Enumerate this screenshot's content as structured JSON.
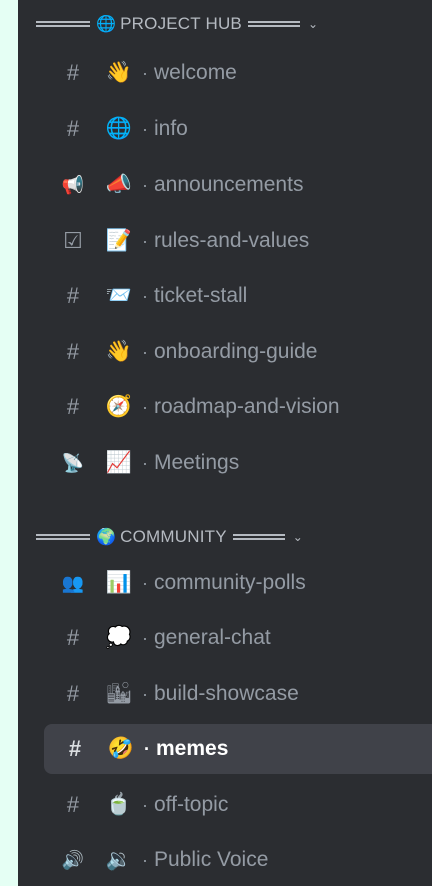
{
  "categories": [
    {
      "label": "PROJECT HUB",
      "emoji": "🌐"
    },
    {
      "label": "COMMUNITY",
      "emoji": "🌍"
    }
  ],
  "channels": [
    {
      "icon": "#",
      "emoji": "👋",
      "name": "welcome"
    },
    {
      "icon": "#",
      "emoji": "🌐",
      "name": "info"
    },
    {
      "icon": "📢",
      "emoji": "📣",
      "name": "announcements"
    },
    {
      "icon": "☑",
      "emoji": "📝",
      "name": "rules-and-values"
    },
    {
      "icon": "#",
      "emoji": "📨",
      "name": "ticket-stall"
    },
    {
      "icon": "#",
      "emoji": "👋",
      "name": "onboarding-guide"
    },
    {
      "icon": "#",
      "emoji": "🧭",
      "name": "roadmap-and-vision"
    },
    {
      "icon": "📡",
      "emoji": "📈",
      "name": "Meetings"
    },
    {
      "icon": "👥",
      "emoji": "📊",
      "name": "community-polls"
    },
    {
      "icon": "#",
      "emoji": "💭",
      "name": "general-chat"
    },
    {
      "icon": "#",
      "emoji": "🏙",
      "name": "build-showcase"
    },
    {
      "icon": "#",
      "emoji": "🤣",
      "name": "memes"
    },
    {
      "icon": "#",
      "emoji": "🍵",
      "name": "off-topic"
    },
    {
      "icon": "🔊",
      "emoji": "🔉",
      "name": "Public Voice"
    }
  ],
  "separator": "·",
  "colors": {
    "panel": "#2b2d31",
    "outer": "#e5fff4",
    "active": "#404249"
  }
}
